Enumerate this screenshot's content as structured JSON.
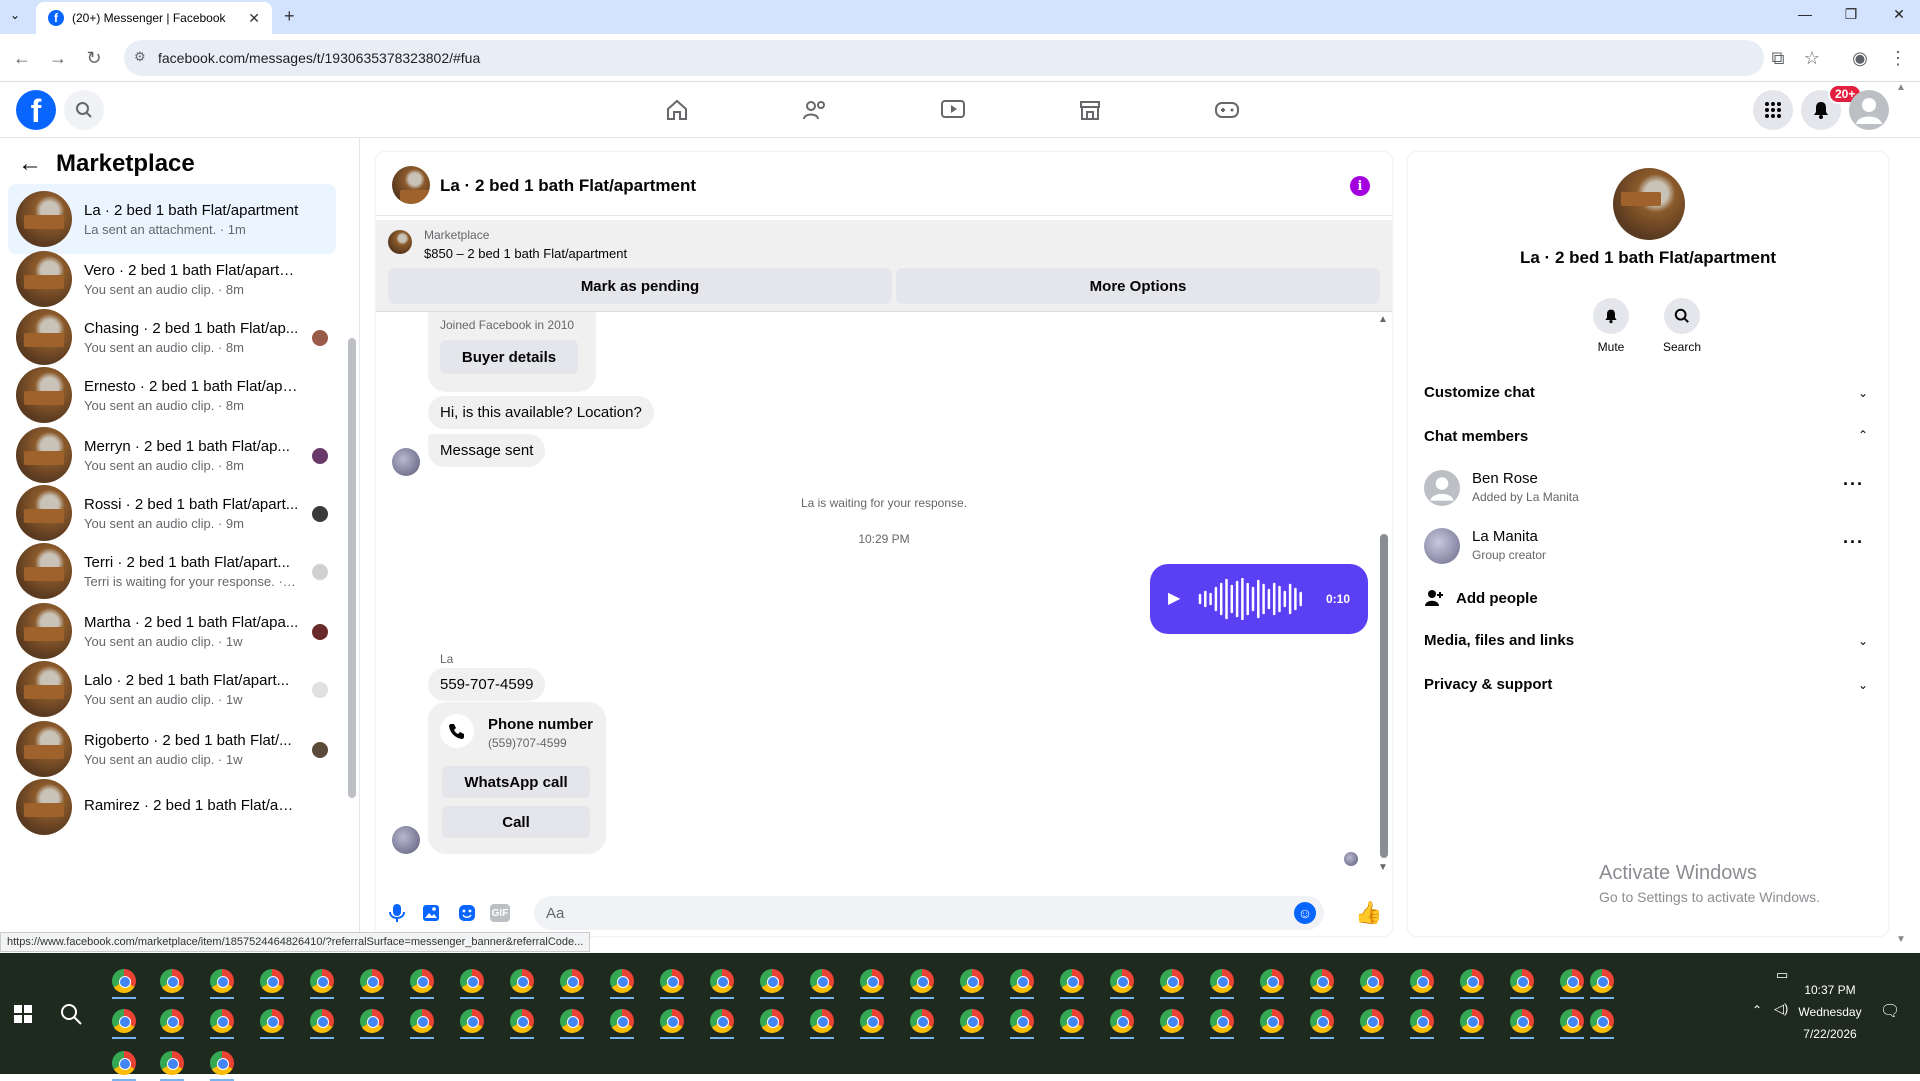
{
  "browser": {
    "tab_title": "(20+) Messenger | Facebook",
    "url": "facebook.com/messages/t/1930635378323802/#fua",
    "status_url": "https://www.facebook.com/marketplace/item/1857524464826410/?referralSurface=messenger_banner&referralCode..."
  },
  "fb": {
    "notif_badge": "20+",
    "brand_color": "#0866ff"
  },
  "left": {
    "title": "Marketplace",
    "conversations": [
      {
        "name": "La · 2 bed 1 bath Flat/apartment",
        "sub": "La sent an attachment. · 1m"
      },
      {
        "name": "Vero · 2 bed 1 bath Flat/apartment",
        "sub": "You sent an audio clip. · 8m"
      },
      {
        "name": "Chasing · 2 bed 1 bath Flat/ap...",
        "sub": "You sent an audio clip. · 8m"
      },
      {
        "name": "Ernesto · 2 bed 1 bath Flat/apart...",
        "sub": "You sent an audio clip. · 8m"
      },
      {
        "name": "Merryn · 2 bed 1 bath Flat/ap...",
        "sub": "You sent an audio clip. · 8m"
      },
      {
        "name": "Rossi · 2 bed 1 bath Flat/apart...",
        "sub": "You sent an audio clip. · 9m"
      },
      {
        "name": "Terri · 2 bed 1 bath Flat/apart...",
        "sub": "Terri is waiting for your response. · 1w"
      },
      {
        "name": "Martha · 2 bed 1 bath Flat/apa...",
        "sub": "You sent an audio clip. · 1w"
      },
      {
        "name": "Lalo · 2 bed 1 bath Flat/apart...",
        "sub": "You sent an audio clip. · 1w"
      },
      {
        "name": "Rigoberto · 2 bed 1 bath Flat/...",
        "sub": "You sent an audio clip. · 1w"
      },
      {
        "name": "Ramirez · 2 bed 1 bath Flat/ap...",
        "sub": ""
      }
    ]
  },
  "chat": {
    "title": "La · 2 bed 1 bath Flat/apartment",
    "marketplace_label": "Marketplace",
    "listing": "$850 – 2 bed 1 bath Flat/apartment",
    "mark_pending": "Mark as pending",
    "more_options": "More Options",
    "joined": "Joined Facebook in 2010",
    "buyer_details": "Buyer details",
    "msg1": "Hi, is this available? Location?",
    "msg2": "Message sent",
    "waiting": "La is waiting for your response.",
    "time": "10:29 PM",
    "audio_duration": "0:10",
    "sender": "La",
    "phone_msg": "559-707-4599",
    "phone_card_title": "Phone number",
    "phone_card_sub": "(559)707-4599",
    "whatsapp_call": "WhatsApp call",
    "call": "Call",
    "composer_placeholder": "Aa",
    "accent_color": "#5b3ff5"
  },
  "info": {
    "title": "La · 2 bed 1 bath Flat/apartment",
    "mute": "Mute",
    "search": "Search",
    "customize": "Customize chat",
    "members_header": "Chat members",
    "members": [
      {
        "name": "Ben Rose",
        "sub": "Added by La Manita"
      },
      {
        "name": "La Manita",
        "sub": "Group creator"
      }
    ],
    "add_people": "Add people",
    "media": "Media, files and links",
    "privacy": "Privacy & support",
    "activate_title": "Activate Windows",
    "activate_sub": "Go to Settings to activate Windows."
  },
  "taskbar": {
    "time": "10:37 PM",
    "day": "Wednesday",
    "date": "7/22/2026"
  }
}
